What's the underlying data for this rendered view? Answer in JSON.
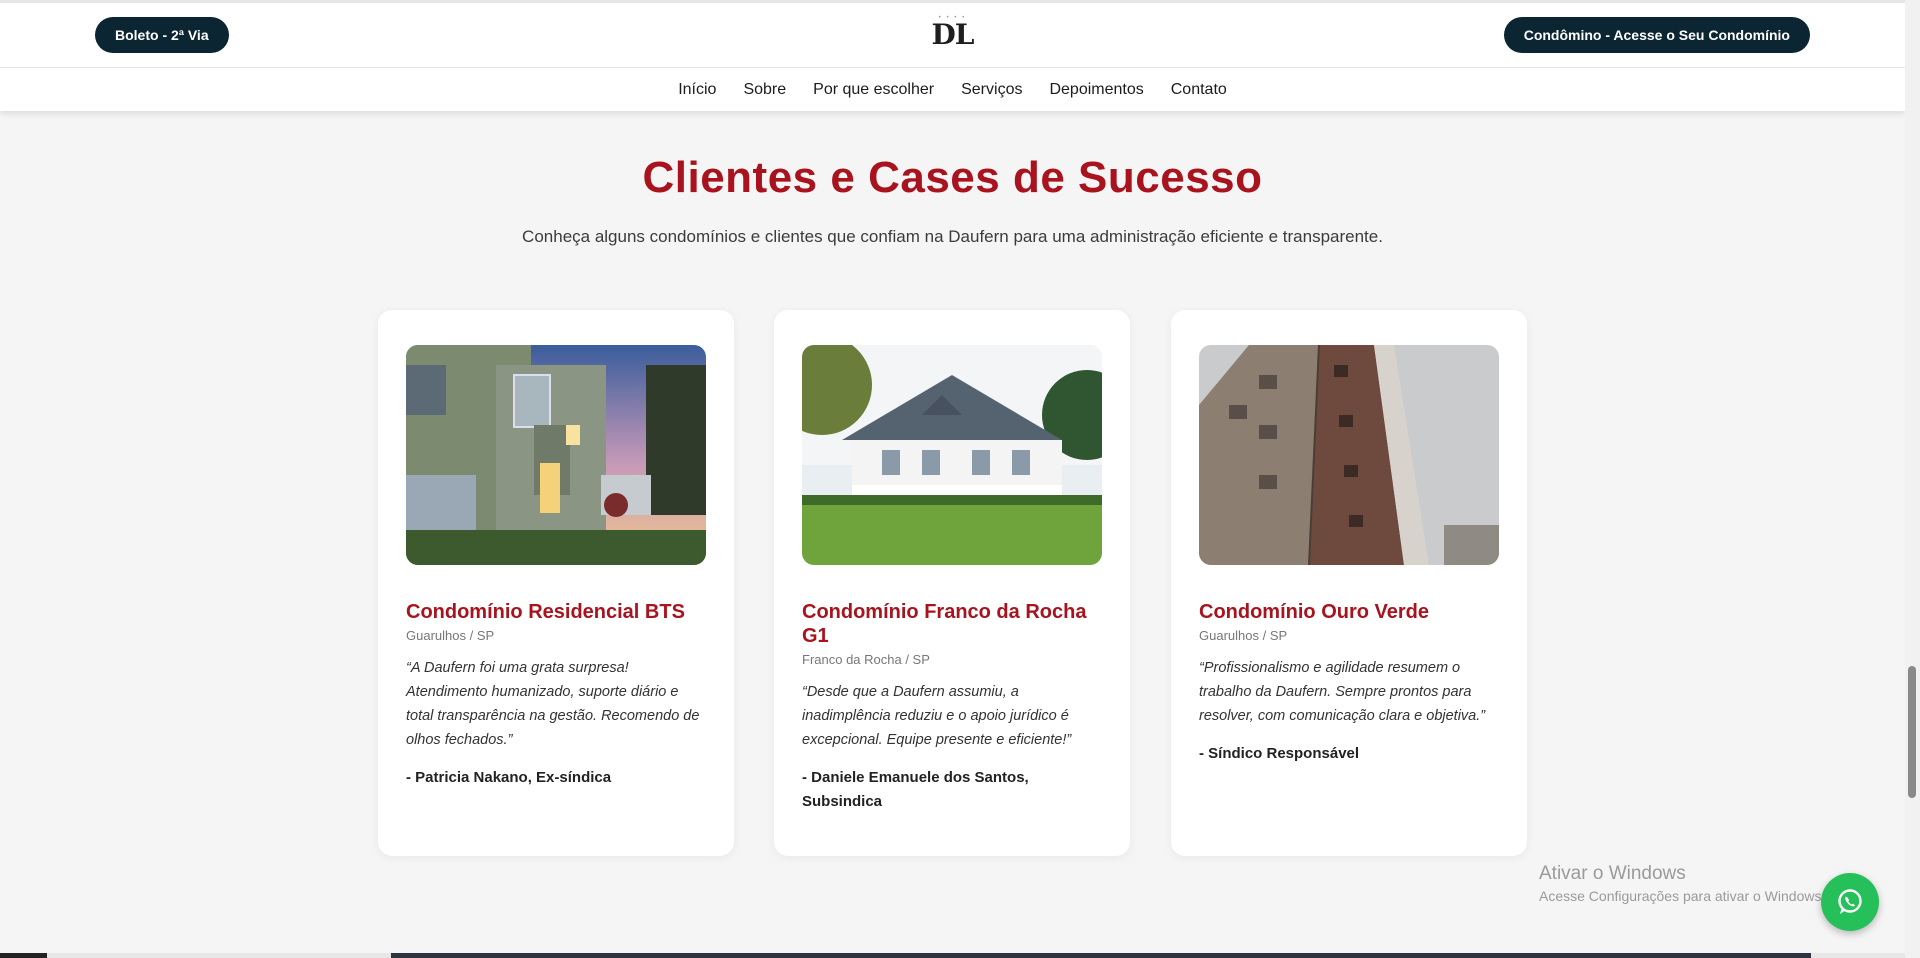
{
  "header": {
    "left_button": "Boleto - 2ª Via",
    "right_button": "Condômino - Acesse o Seu Condomínio",
    "logo_text": "DL"
  },
  "nav": {
    "items": [
      "Início",
      "Sobre",
      "Por que escolher",
      "Serviços",
      "Depoimentos",
      "Contato"
    ]
  },
  "section": {
    "title": "Clientes e Cases de Sucesso",
    "subtitle": "Conheça alguns condomínios e clientes que confiam na Daufern para uma administração eficiente e transparente."
  },
  "cards": [
    {
      "name": "Condomínio Residencial BTS",
      "location": "Guarulhos / SP",
      "quote": "“A Daufern foi uma grata surpresa! Atendimento humanizado, suporte diário e total transparência na gestão. Recomendo de olhos fechados.”",
      "author": "- Patricia Nakano, Ex-síndica"
    },
    {
      "name": "Condomínio Franco da Rocha G1",
      "location": "Franco da Rocha / SP",
      "quote": "“Desde que a Daufern assumiu, a inadimplência reduziu e o apoio jurídico é excepcional. Equipe presente e eficiente!”",
      "author": "- Daniele Emanuele dos Santos, Subsindica"
    },
    {
      "name": "Condomínio Ouro Verde",
      "location": "Guarulhos / SP",
      "quote": "“Profissionalismo e agilidade resumem o trabalho da Daufern. Sempre prontos para resolver, com comunicação clara e objetiva.”",
      "author": "- Síndico Responsável"
    }
  ],
  "watermark": {
    "line1": "Ativar o Windows",
    "line2": "Acesse Configurações para ativar o Windows."
  },
  "colors": {
    "accent_red": "#a8131e",
    "dark_button": "#0b2533",
    "whatsapp_green": "#25c05a"
  },
  "icons": {
    "floating_button": "whatsapp-icon"
  }
}
